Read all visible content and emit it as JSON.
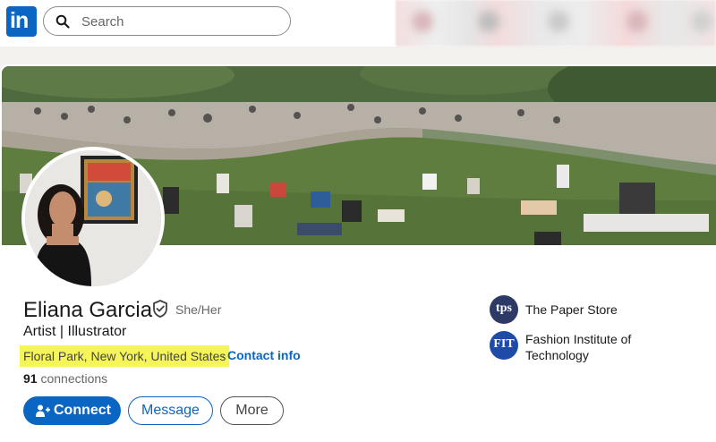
{
  "topbar": {
    "logo_text": "in",
    "search_placeholder": "Search"
  },
  "profile": {
    "name": "Eliana Garcia",
    "pronouns": "She/Her",
    "headline": "Artist | Illustrator",
    "location": "Floral Park, New York, United States",
    "separator": "·",
    "contact_info": "Contact info",
    "connections_count": "91",
    "connections_label": "connections"
  },
  "actions": {
    "connect": "Connect",
    "message": "Message",
    "more": "More"
  },
  "experience": [
    {
      "logo_text": "tps",
      "name_line1": "The Paper Store",
      "name_line2": ""
    },
    {
      "logo_text": "FIT",
      "name_line1": "Fashion Institute of",
      "name_line2": "Technology"
    }
  ],
  "colors": {
    "brand": "#0a66c2",
    "highlight": "#f5f55a",
    "tps_logo": "#2d3a66",
    "fit_logo": "#1e4ba8"
  }
}
